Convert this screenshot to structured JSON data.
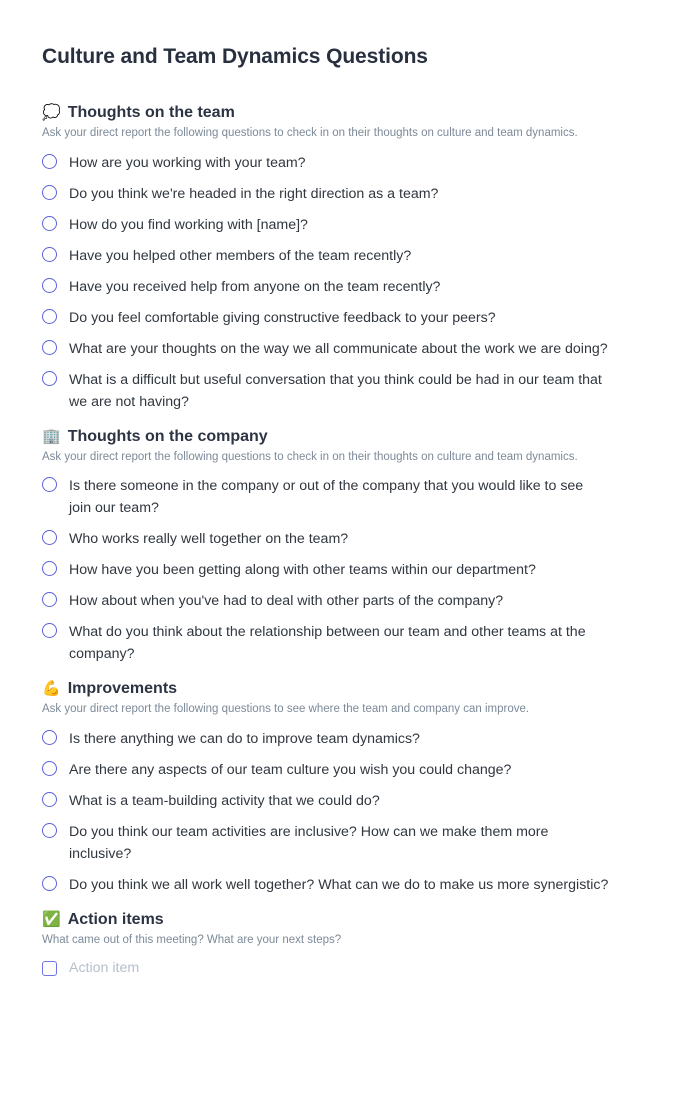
{
  "document": {
    "title": "Culture and Team Dynamics Questions"
  },
  "colors": {
    "radio_outline": "#5d62dd",
    "checkbox_outline": "#6f74e8",
    "heading": "#2c3443",
    "body_text": "#30373f",
    "muted_text": "#7d8a99",
    "placeholder_text": "#b6bfcc",
    "background": "#ffffff"
  },
  "sections": [
    {
      "emoji": "💭",
      "emoji_name": "thought-balloon-icon",
      "title": "Thoughts on the team",
      "description": "Ask your direct report the following questions to check in on their thoughts on culture and team dynamics.",
      "control_type": "radio",
      "questions": [
        "How are you working with your team?",
        "Do you think we're headed in the right direction as a team?",
        "How do you find working with [name]?",
        "Have you helped other members of the team recently?",
        "Have you received help from anyone on the team recently?",
        "Do you feel comfortable giving constructive feedback to your peers?",
        "What are your thoughts on the way we all communicate about the work we are doing?",
        "What is a difficult but useful conversation that you think could be had in our team that we are not having?"
      ]
    },
    {
      "emoji": "🏢",
      "emoji_name": "office-building-icon",
      "title": "Thoughts on the company",
      "description": "Ask your direct report the following questions to check in on their thoughts on culture and team dynamics.",
      "control_type": "radio",
      "questions": [
        "Is there someone in the company or out of the company that you would like to see join our team?",
        "Who works really well together on the team?",
        "How have you been getting along with other teams within our department?",
        "How about when you've had to deal with other parts of the company?",
        "What do you think about the relationship between our team and other teams at the company?"
      ]
    },
    {
      "emoji": "💪",
      "emoji_name": "flexed-biceps-icon",
      "title": "Improvements",
      "description": "Ask your direct report the following questions to see where the team and company can improve.",
      "control_type": "radio",
      "questions": [
        "Is there anything we can do to improve team dynamics?",
        "Are there any aspects of our team culture you wish you could change?",
        "What is a team-building activity that we could do?",
        "Do you think our team activities are inclusive? How can we make them more inclusive?",
        "Do you think we all work well together? What can we do to make us more synergistic?"
      ]
    },
    {
      "emoji": "✅",
      "emoji_name": "check-mark-button-icon",
      "title": "Action items",
      "description": "What came out of this meeting? What are your next steps?",
      "control_type": "checkbox",
      "questions": [],
      "action_items": [
        {
          "placeholder": "Action item",
          "checked": false
        }
      ]
    }
  ]
}
